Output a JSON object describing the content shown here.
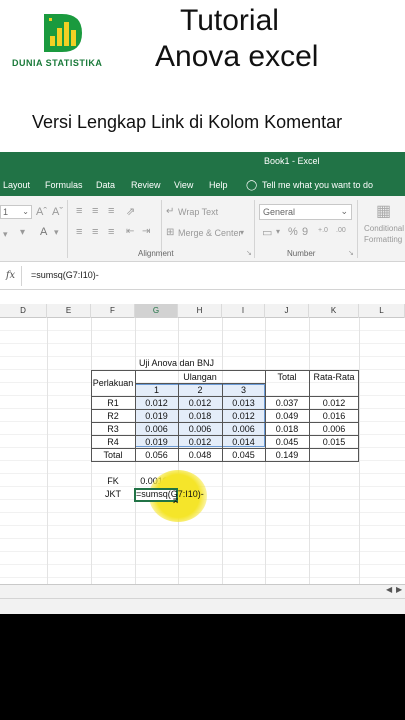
{
  "header": {
    "logo_text": "DUNIA STATISTIKA",
    "title_line1": "Tutorial",
    "title_line2": "Anova excel",
    "subtitle": "Versi Lengkap Link di Kolom Komentar"
  },
  "window": {
    "title": "Book1  -  Excel"
  },
  "menu": {
    "items": [
      "Layout",
      "Formulas",
      "Data",
      "Review",
      "View",
      "Help"
    ],
    "tell_me": "Tell me what you want to do"
  },
  "ribbon": {
    "font_size": "1",
    "wrap_text": "Wrap Text",
    "merge_center": "Merge & Center",
    "number_format": "General",
    "alignment_label": "Alignment",
    "number_label": "Number",
    "conditional_formatting_line1": "Conditional",
    "conditional_formatting_line2": "Formatting",
    "percent": "%",
    "comma": "9",
    "increase_decimal": "+.0",
    "decrease_decimal": ".00"
  },
  "formula_bar": {
    "fx": "fx",
    "formula": "=sumsq(G7:I10)-"
  },
  "columns": [
    "D",
    "E",
    "F",
    "G",
    "H",
    "I",
    "J",
    "K",
    "L"
  ],
  "table": {
    "title": "Uji Anova dan BNJ",
    "perlakuan": "Perlakuan",
    "ulangan": "Ulangan",
    "total": "Total",
    "rata_rata": "Rata-Rata",
    "ulangan_cols": [
      "1",
      "2",
      "3"
    ],
    "rows": [
      {
        "label": "R1",
        "values": [
          "0.012",
          "0.012",
          "0.013"
        ],
        "total": "0.037",
        "avg": "0.012"
      },
      {
        "label": "R2",
        "values": [
          "0.019",
          "0.018",
          "0.012"
        ],
        "total": "0.049",
        "avg": "0.016"
      },
      {
        "label": "R3",
        "values": [
          "0.006",
          "0.006",
          "0.006"
        ],
        "total": "0.018",
        "avg": "0.006"
      },
      {
        "label": "R4",
        "values": [
          "0.019",
          "0.012",
          "0.014"
        ],
        "total": "0.045",
        "avg": "0.015"
      }
    ],
    "total_row": {
      "label": "Total",
      "values": [
        "0.056",
        "0.048",
        "0.045"
      ],
      "grand_total": "0.149"
    }
  },
  "calc": {
    "fk_label": "FK",
    "fk_value": "0.00185",
    "jkt_label": "JKT",
    "jkt_formula": "=sumsq(G7:I10)-"
  },
  "colors": {
    "excel_green": "#217346",
    "highlight": "#f5e52a",
    "logo_green": "#1a7a3a"
  }
}
